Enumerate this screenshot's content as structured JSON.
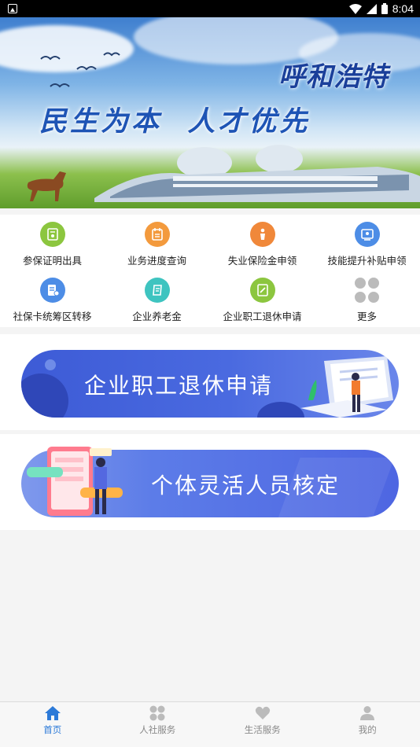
{
  "status_bar": {
    "time": "8:04"
  },
  "banner": {
    "city": "呼和浩特",
    "slogan_left": "民生为本",
    "slogan_right": "人才优先"
  },
  "grid": {
    "items": [
      {
        "label": "参保证明出具",
        "icon": "certificate-icon",
        "color": "#8cc63f"
      },
      {
        "label": "业务进度查询",
        "icon": "progress-query-icon",
        "color": "#f39a3d"
      },
      {
        "label": "失业保险金申领",
        "icon": "unemployment-icon",
        "color": "#f0883a"
      },
      {
        "label": "技能提升补贴申领",
        "icon": "skill-subsidy-icon",
        "color": "#4d8de6"
      },
      {
        "label": "社保卡统筹区转移",
        "icon": "card-transfer-icon",
        "color": "#4d8de6"
      },
      {
        "label": "企业养老金",
        "icon": "pension-icon",
        "color": "#3ec4c0"
      },
      {
        "label": "企业职工退休申请",
        "icon": "retirement-apply-icon",
        "color": "#8cc63f"
      },
      {
        "label": "更多",
        "icon": "more-icon",
        "color": "#bbbbbb"
      }
    ]
  },
  "cards": [
    {
      "label": "企业职工退休申请"
    },
    {
      "label": "个体灵活人员核定"
    }
  ],
  "tabbar": {
    "items": [
      {
        "label": "首页",
        "icon": "home-icon",
        "active": true
      },
      {
        "label": "人社服务",
        "icon": "services-icon",
        "active": false
      },
      {
        "label": "生活服务",
        "icon": "heart-icon",
        "active": false
      },
      {
        "label": "我的",
        "icon": "profile-icon",
        "active": false
      }
    ]
  },
  "colors": {
    "accent": "#2c7ad8",
    "banner_blue": "#3d5bd6"
  }
}
